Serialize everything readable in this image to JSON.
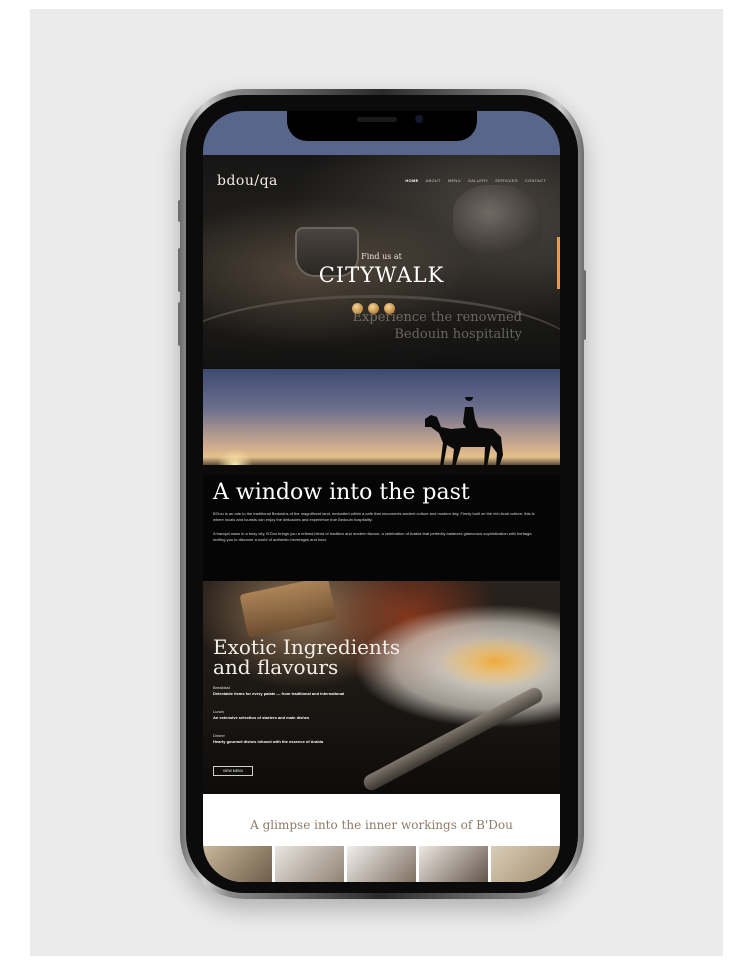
{
  "site": {
    "logo": "bdou/qa",
    "nav": [
      "Home",
      "About",
      "Menu",
      "Gallery",
      "Services",
      "Contact"
    ]
  },
  "hero": {
    "pre_title": "Find us at",
    "title": "CITYWALK",
    "subtitle_line1": "Experience the renowned",
    "subtitle_line2": "Bedouin hospitality"
  },
  "past": {
    "title": "A window into the past",
    "paragraph1": "B'Dou is an ode to the traditional Bedouins of the magnificent land, embodied within a café that reconnects ancient culture and modern day. Firmly built on the rich Arab culture, this is where locals and tourists can enjoy the delicacies and experience true Bedouin hospitality.",
    "paragraph2": "A tranquil oasis in a busy city, B'Dou brings you a refined blend of tradition and modern flavour, a celebration of Arabia that perfectly balances glamorous sophistication with heritage, inviting you to discover a world of authentic beverages and food.",
    "paragraph3": ""
  },
  "food": {
    "title_line1": "Exotic Ingredients",
    "title_line2": "and flavours",
    "items": [
      {
        "heading": "Breakfast",
        "text": "Delectable items for every palate — from traditional and international"
      },
      {
        "heading": "Lunch",
        "text": "An extensive selection of starters and main dishes"
      },
      {
        "heading": "Dinner",
        "text": "Hearty gourmet dishes infused with the essence of Arabia"
      }
    ],
    "button_label": "VIEW MENU"
  },
  "glimpse": {
    "title": "A glimpse into the inner workings of B'Dou"
  },
  "colors": {
    "status_bar": "#59668b",
    "accent_scroll": "#e79b4f",
    "background": "#ebebeb"
  }
}
